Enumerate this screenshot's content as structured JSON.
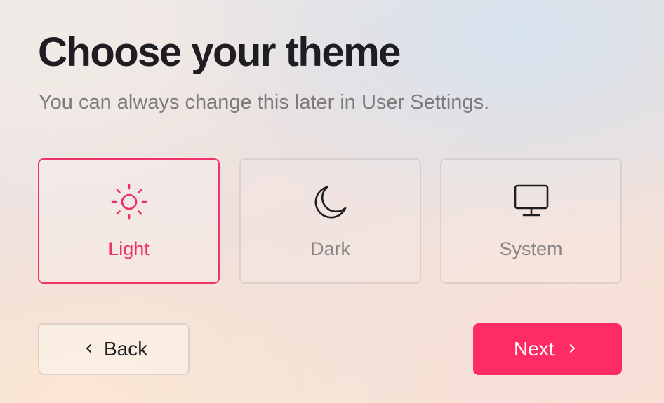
{
  "page": {
    "title": "Choose your theme",
    "subtitle": "You can always change this later in User Settings."
  },
  "options": [
    {
      "id": "light",
      "label": "Light",
      "icon": "sun-icon",
      "selected": true
    },
    {
      "id": "dark",
      "label": "Dark",
      "icon": "moon-icon",
      "selected": false
    },
    {
      "id": "system",
      "label": "System",
      "icon": "monitor-icon",
      "selected": false
    }
  ],
  "buttons": {
    "back_label": "Back",
    "back_icon": "chevron-left-icon",
    "next_label": "Next",
    "next_icon": "chevron-right-icon"
  },
  "colors": {
    "accent": "#ff2b64",
    "selected_text": "#ee2f65",
    "title": "#1e1e22",
    "muted": "#7d7b7b"
  }
}
